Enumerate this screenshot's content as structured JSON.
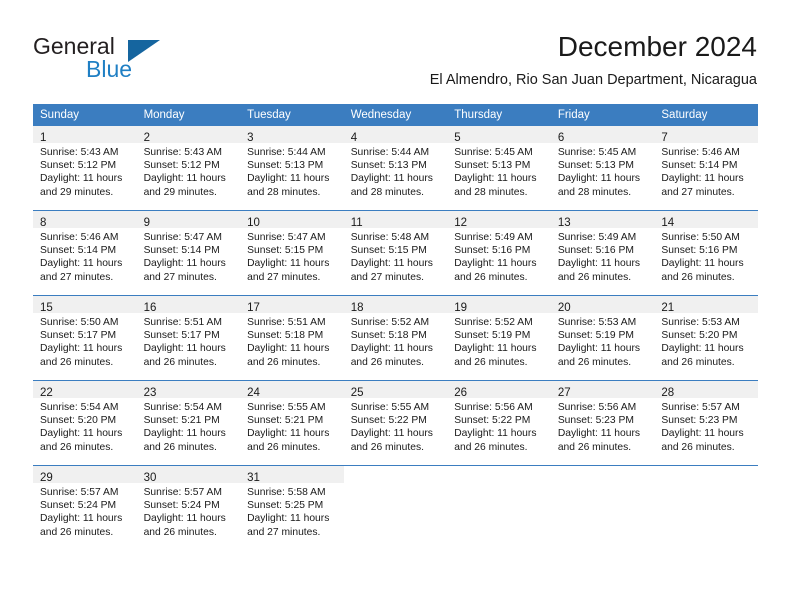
{
  "logo": {
    "primary_text": "General",
    "secondary_text": "Blue",
    "triangle_color": "#15659f",
    "blue_color": "#1f7fc4"
  },
  "header": {
    "month_title": "December 2024",
    "location": "El Almendro, Rio San Juan Department, Nicaragua"
  },
  "theme": {
    "header_row_bg": "#3b7dc0",
    "daynum_band_bg": "#f0f0f0",
    "grid_line": "#3b7dc0",
    "text": "#1a1a1a"
  },
  "weekday_headers": [
    "Sunday",
    "Monday",
    "Tuesday",
    "Wednesday",
    "Thursday",
    "Friday",
    "Saturday"
  ],
  "weeks": [
    [
      {
        "day": "1",
        "sunrise": "Sunrise: 5:43 AM",
        "sunset": "Sunset: 5:12 PM",
        "daylight_1": "Daylight: 11 hours",
        "daylight_2": "and 29 minutes."
      },
      {
        "day": "2",
        "sunrise": "Sunrise: 5:43 AM",
        "sunset": "Sunset: 5:12 PM",
        "daylight_1": "Daylight: 11 hours",
        "daylight_2": "and 29 minutes."
      },
      {
        "day": "3",
        "sunrise": "Sunrise: 5:44 AM",
        "sunset": "Sunset: 5:13 PM",
        "daylight_1": "Daylight: 11 hours",
        "daylight_2": "and 28 minutes."
      },
      {
        "day": "4",
        "sunrise": "Sunrise: 5:44 AM",
        "sunset": "Sunset: 5:13 PM",
        "daylight_1": "Daylight: 11 hours",
        "daylight_2": "and 28 minutes."
      },
      {
        "day": "5",
        "sunrise": "Sunrise: 5:45 AM",
        "sunset": "Sunset: 5:13 PM",
        "daylight_1": "Daylight: 11 hours",
        "daylight_2": "and 28 minutes."
      },
      {
        "day": "6",
        "sunrise": "Sunrise: 5:45 AM",
        "sunset": "Sunset: 5:13 PM",
        "daylight_1": "Daylight: 11 hours",
        "daylight_2": "and 28 minutes."
      },
      {
        "day": "7",
        "sunrise": "Sunrise: 5:46 AM",
        "sunset": "Sunset: 5:14 PM",
        "daylight_1": "Daylight: 11 hours",
        "daylight_2": "and 27 minutes."
      }
    ],
    [
      {
        "day": "8",
        "sunrise": "Sunrise: 5:46 AM",
        "sunset": "Sunset: 5:14 PM",
        "daylight_1": "Daylight: 11 hours",
        "daylight_2": "and 27 minutes."
      },
      {
        "day": "9",
        "sunrise": "Sunrise: 5:47 AM",
        "sunset": "Sunset: 5:14 PM",
        "daylight_1": "Daylight: 11 hours",
        "daylight_2": "and 27 minutes."
      },
      {
        "day": "10",
        "sunrise": "Sunrise: 5:47 AM",
        "sunset": "Sunset: 5:15 PM",
        "daylight_1": "Daylight: 11 hours",
        "daylight_2": "and 27 minutes."
      },
      {
        "day": "11",
        "sunrise": "Sunrise: 5:48 AM",
        "sunset": "Sunset: 5:15 PM",
        "daylight_1": "Daylight: 11 hours",
        "daylight_2": "and 27 minutes."
      },
      {
        "day": "12",
        "sunrise": "Sunrise: 5:49 AM",
        "sunset": "Sunset: 5:16 PM",
        "daylight_1": "Daylight: 11 hours",
        "daylight_2": "and 26 minutes."
      },
      {
        "day": "13",
        "sunrise": "Sunrise: 5:49 AM",
        "sunset": "Sunset: 5:16 PM",
        "daylight_1": "Daylight: 11 hours",
        "daylight_2": "and 26 minutes."
      },
      {
        "day": "14",
        "sunrise": "Sunrise: 5:50 AM",
        "sunset": "Sunset: 5:16 PM",
        "daylight_1": "Daylight: 11 hours",
        "daylight_2": "and 26 minutes."
      }
    ],
    [
      {
        "day": "15",
        "sunrise": "Sunrise: 5:50 AM",
        "sunset": "Sunset: 5:17 PM",
        "daylight_1": "Daylight: 11 hours",
        "daylight_2": "and 26 minutes."
      },
      {
        "day": "16",
        "sunrise": "Sunrise: 5:51 AM",
        "sunset": "Sunset: 5:17 PM",
        "daylight_1": "Daylight: 11 hours",
        "daylight_2": "and 26 minutes."
      },
      {
        "day": "17",
        "sunrise": "Sunrise: 5:51 AM",
        "sunset": "Sunset: 5:18 PM",
        "daylight_1": "Daylight: 11 hours",
        "daylight_2": "and 26 minutes."
      },
      {
        "day": "18",
        "sunrise": "Sunrise: 5:52 AM",
        "sunset": "Sunset: 5:18 PM",
        "daylight_1": "Daylight: 11 hours",
        "daylight_2": "and 26 minutes."
      },
      {
        "day": "19",
        "sunrise": "Sunrise: 5:52 AM",
        "sunset": "Sunset: 5:19 PM",
        "daylight_1": "Daylight: 11 hours",
        "daylight_2": "and 26 minutes."
      },
      {
        "day": "20",
        "sunrise": "Sunrise: 5:53 AM",
        "sunset": "Sunset: 5:19 PM",
        "daylight_1": "Daylight: 11 hours",
        "daylight_2": "and 26 minutes."
      },
      {
        "day": "21",
        "sunrise": "Sunrise: 5:53 AM",
        "sunset": "Sunset: 5:20 PM",
        "daylight_1": "Daylight: 11 hours",
        "daylight_2": "and 26 minutes."
      }
    ],
    [
      {
        "day": "22",
        "sunrise": "Sunrise: 5:54 AM",
        "sunset": "Sunset: 5:20 PM",
        "daylight_1": "Daylight: 11 hours",
        "daylight_2": "and 26 minutes."
      },
      {
        "day": "23",
        "sunrise": "Sunrise: 5:54 AM",
        "sunset": "Sunset: 5:21 PM",
        "daylight_1": "Daylight: 11 hours",
        "daylight_2": "and 26 minutes."
      },
      {
        "day": "24",
        "sunrise": "Sunrise: 5:55 AM",
        "sunset": "Sunset: 5:21 PM",
        "daylight_1": "Daylight: 11 hours",
        "daylight_2": "and 26 minutes."
      },
      {
        "day": "25",
        "sunrise": "Sunrise: 5:55 AM",
        "sunset": "Sunset: 5:22 PM",
        "daylight_1": "Daylight: 11 hours",
        "daylight_2": "and 26 minutes."
      },
      {
        "day": "26",
        "sunrise": "Sunrise: 5:56 AM",
        "sunset": "Sunset: 5:22 PM",
        "daylight_1": "Daylight: 11 hours",
        "daylight_2": "and 26 minutes."
      },
      {
        "day": "27",
        "sunrise": "Sunrise: 5:56 AM",
        "sunset": "Sunset: 5:23 PM",
        "daylight_1": "Daylight: 11 hours",
        "daylight_2": "and 26 minutes."
      },
      {
        "day": "28",
        "sunrise": "Sunrise: 5:57 AM",
        "sunset": "Sunset: 5:23 PM",
        "daylight_1": "Daylight: 11 hours",
        "daylight_2": "and 26 minutes."
      }
    ],
    [
      {
        "day": "29",
        "sunrise": "Sunrise: 5:57 AM",
        "sunset": "Sunset: 5:24 PM",
        "daylight_1": "Daylight: 11 hours",
        "daylight_2": "and 26 minutes."
      },
      {
        "day": "30",
        "sunrise": "Sunrise: 5:57 AM",
        "sunset": "Sunset: 5:24 PM",
        "daylight_1": "Daylight: 11 hours",
        "daylight_2": "and 26 minutes."
      },
      {
        "day": "31",
        "sunrise": "Sunrise: 5:58 AM",
        "sunset": "Sunset: 5:25 PM",
        "daylight_1": "Daylight: 11 hours",
        "daylight_2": "and 27 minutes."
      },
      {
        "day": "",
        "sunrise": "",
        "sunset": "",
        "daylight_1": "",
        "daylight_2": ""
      },
      {
        "day": "",
        "sunrise": "",
        "sunset": "",
        "daylight_1": "",
        "daylight_2": ""
      },
      {
        "day": "",
        "sunrise": "",
        "sunset": "",
        "daylight_1": "",
        "daylight_2": ""
      },
      {
        "day": "",
        "sunrise": "",
        "sunset": "",
        "daylight_1": "",
        "daylight_2": ""
      }
    ]
  ]
}
